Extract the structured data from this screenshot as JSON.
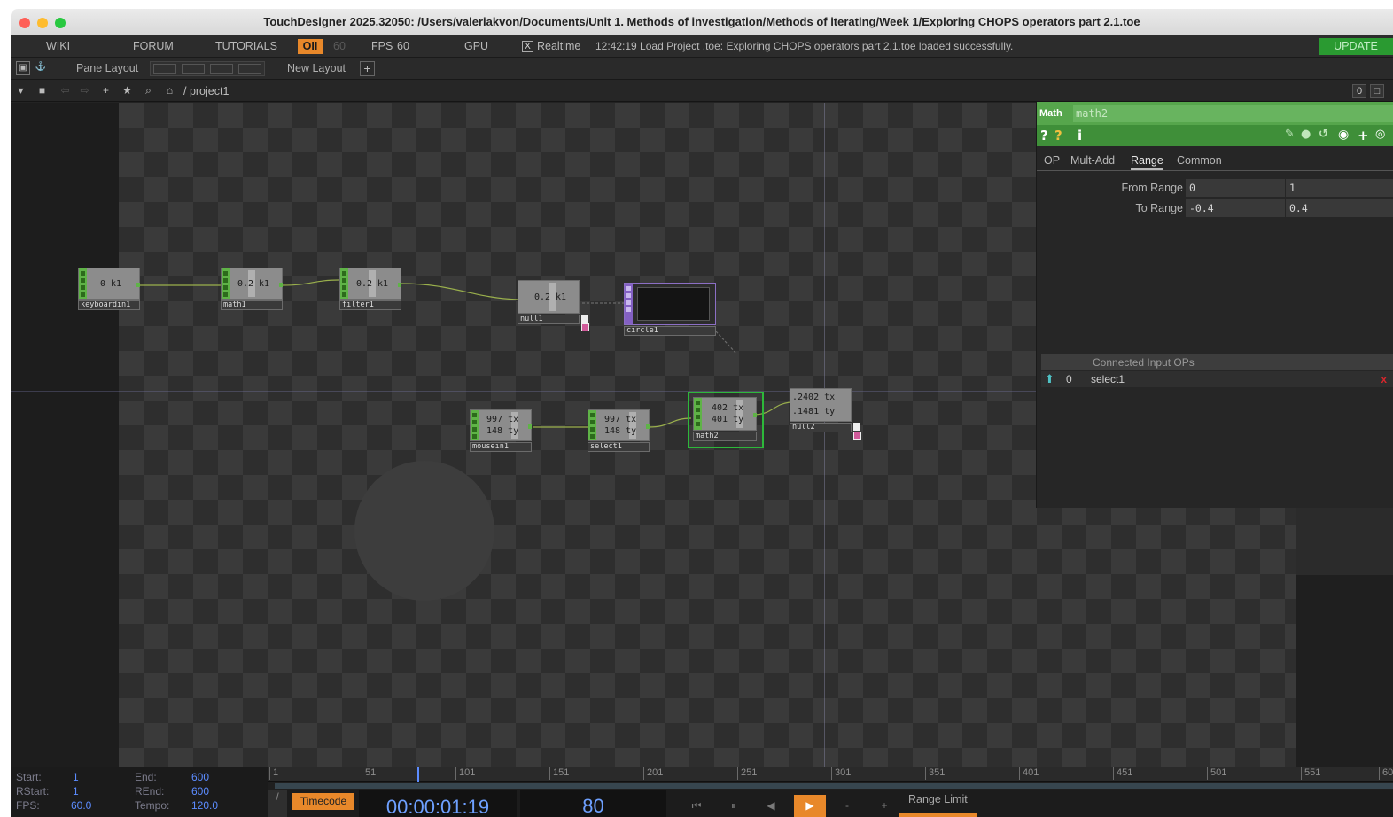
{
  "window": {
    "title": "TouchDesigner 2025.32050: /Users/valeriakvon/Documents/Unit 1. Methods of investigation/Methods of iterating/Week 1/Exploring CHOPS operators part 2.1.toe"
  },
  "menubar": {
    "wiki": "WIKI",
    "forum": "FORUM",
    "tutorials": "TUTORIALS",
    "oi": "OII",
    "fps_dim": "60",
    "fps_label": "FPS",
    "fps_value": "60",
    "gpu": "GPU",
    "realtime_check": "X",
    "realtime": "Realtime",
    "status": "12:42:19 Load Project .toe: Exploring CHOPS operators part 2.1.toe loaded successfully.",
    "update": "UPDATE"
  },
  "panebar": {
    "pane_layout": "Pane Layout",
    "new_layout": "New Layout",
    "plus": "+"
  },
  "pathbar": {
    "path": "/ project1",
    "zoom": "0"
  },
  "nodes": {
    "keyboardin1": {
      "label": "keyboardin1",
      "value": "0 k1"
    },
    "math1": {
      "label": "math1",
      "value": "0.2 k1"
    },
    "filter1": {
      "label": "filter1",
      "value": "0.2 k1"
    },
    "null1": {
      "label": "null1",
      "value": "0.2 k1"
    },
    "circle1": {
      "label": "circle1"
    },
    "mousein1": {
      "label": "mousein1",
      "v1": "997 tx",
      "v2": "148 ty"
    },
    "select1": {
      "label": "select1",
      "v1": "997 tx",
      "v2": "148 ty"
    },
    "math2": {
      "label": "math2",
      "v1": "402 tx",
      "v2": "401 ty"
    },
    "null2": {
      "label": "null2",
      "v1": ".2402 tx",
      "v2": ".1481 ty"
    }
  },
  "params": {
    "type": "Math",
    "name": "math2",
    "icons": {
      "help": "?",
      "info": "i",
      "plus": "+"
    },
    "tabs": [
      "OP",
      "Mult-Add",
      "Range",
      "Common"
    ],
    "active_tab": "Range",
    "from_range": {
      "label": "From Range",
      "v1": "0",
      "v2": "1"
    },
    "to_range": {
      "label": "To Range",
      "v1": "-0.4",
      "v2": "0.4"
    },
    "connected": {
      "header": "Connected Input OPs",
      "index": "0",
      "name": "select1",
      "remove": "x"
    }
  },
  "timeline": {
    "start_label": "Start:",
    "start": "1",
    "end_label": "End:",
    "end": "600",
    "rstart_label": "RStart:",
    "rstart": "1",
    "rend_label": "REnd:",
    "rend": "600",
    "fps_label": "FPS:",
    "fps": "60.0",
    "tempo_label": "Tempo:",
    "tempo": "120.0",
    "ruler": [
      "1",
      "51",
      "101",
      "151",
      "201",
      "251",
      "301",
      "351",
      "401",
      "451",
      "501",
      "551",
      "60"
    ],
    "timecode_label": "Timecode",
    "timecode": "00:00:01:19",
    "frame": "80",
    "range_limit": "Range Limit",
    "buttons": {
      "rewind": "⏮",
      "pause": "⏸",
      "back": "◀",
      "play": "▶",
      "minus": "-",
      "plus": "+"
    }
  },
  "colors": {
    "chop_green": "#5fb347",
    "top_purple": "#8360c3",
    "accent_orange": "#e8882a",
    "timecode_blue": "#6ea0ff",
    "update_green": "#2a9a31"
  }
}
